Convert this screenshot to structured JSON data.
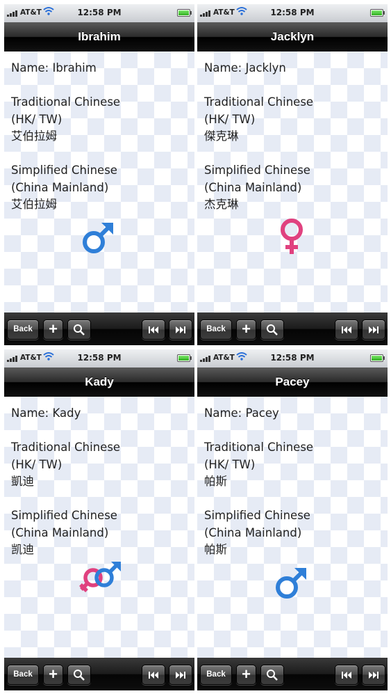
{
  "status_bar": {
    "carrier": "AT&T",
    "time": "12:58 PM"
  },
  "toolbar": {
    "back_label": "Back",
    "add_label": "+",
    "search_icon": "search-icon",
    "first_icon": "skip-to-first-icon",
    "next_icon": "skip-to-next-icon"
  },
  "labels": {
    "traditional_line1": "Traditional Chinese",
    "traditional_line2": "(HK/ TW)",
    "simplified_line1": "Simplified Chinese",
    "simplified_line2": "(China Mainland)"
  },
  "screens": [
    {
      "title": "Ibrahim",
      "name_line": "Name: Ibrahim",
      "traditional": "艾伯拉姆",
      "simplified": "艾伯拉姆",
      "gender": "male"
    },
    {
      "title": "Jacklyn",
      "name_line": "Name: Jacklyn",
      "traditional": "傑克琳",
      "simplified": "杰克琳",
      "gender": "female"
    },
    {
      "title": "Kady",
      "name_line": "Name: Kady",
      "traditional": "凱迪",
      "simplified": "凯迪",
      "gender": "unisex"
    },
    {
      "title": "Pacey",
      "name_line": "Name: Pacey",
      "traditional": "帕斯",
      "simplified": "帕斯",
      "gender": "male"
    }
  ],
  "colors": {
    "male": "#2f7fd8",
    "female": "#e0417f"
  }
}
